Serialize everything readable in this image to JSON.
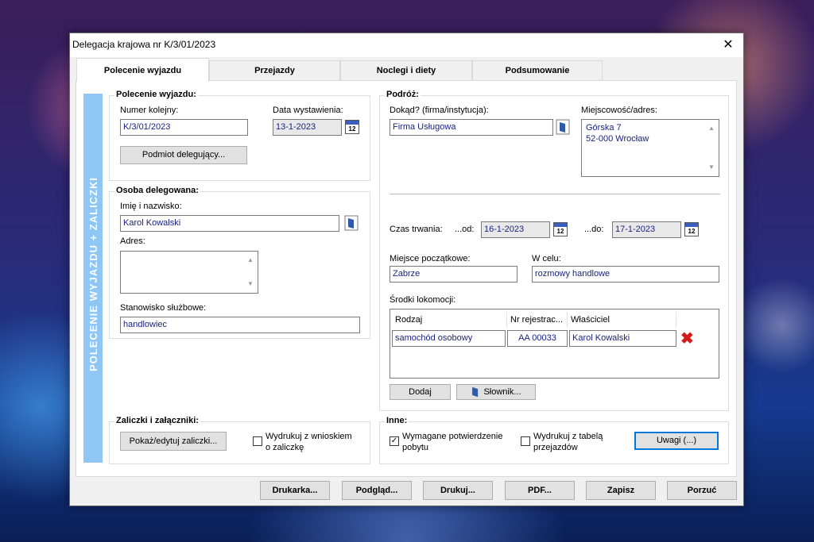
{
  "window": {
    "title": "Delegacja krajowa nr K/3/01/2023",
    "close_glyph": "✕"
  },
  "tabs": [
    "Polecenie wyjazdu",
    "Przejazdy",
    "Noclegi i diety",
    "Podsumowanie"
  ],
  "banner": "POLECENIE WYJAZDU + ZALICZKI",
  "polecenie": {
    "title": "Polecenie wyjazdu:",
    "numer_label": "Numer kolejny:",
    "numer_value": "K/3/01/2023",
    "data_label": "Data wystawienia:",
    "data_value": "13-1-2023",
    "podmiot_button": "Podmiot delegujący..."
  },
  "osoba": {
    "title": "Osoba delegowana:",
    "imie_label": "Imię i nazwisko:",
    "imie_value": "Karol Kowalski",
    "adres_label": "Adres:",
    "stanowisko_label": "Stanowisko służbowe:",
    "stanowisko_value": "handlowiec"
  },
  "podroz": {
    "title": "Podróż:",
    "dokad_label": "Dokąd? (firma/instytucja):",
    "dokad_value": "Firma Usługowa",
    "miejsc_label": "Miejscowość/adres:",
    "miejsc_line1": "Górska 7",
    "miejsc_line2": "52-000 Wrocław",
    "czas_label": "Czas trwania:",
    "od_label": "...od:",
    "od_value": "16-1-2023",
    "do_label": "...do:",
    "do_value": "17-1-2023",
    "poczatkowe_label": "Miejsce początkowe:",
    "poczatkowe_value": "Zabrze",
    "cel_label": "W celu:",
    "cel_value": "rozmowy handlowe",
    "srodki_label": "Środki lokomocji:",
    "columns": [
      "Rodzaj",
      "Nr rejestrac...",
      "Właściciel"
    ],
    "rows": [
      {
        "rodzaj": "samochód osobowy",
        "nr": "AA 00033",
        "wlasciciel": "Karol Kowalski"
      }
    ],
    "dodaj_button": "Dodaj",
    "slownik_button": "Słownik..."
  },
  "zaliczki": {
    "title": "Zaliczki i załączniki:",
    "pokaz_button": "Pokaż/edytuj zaliczki...",
    "wydrukuj_label_1": "Wydrukuj z wnioskiem",
    "wydrukuj_label_2": "o zaliczkę",
    "wydrukuj_checked": false
  },
  "inne": {
    "title": "Inne:",
    "wymagane_label_1": "Wymagane potwierdzenie",
    "wymagane_label_2": "pobytu",
    "wymagane_checked": true,
    "tabela_label_1": "Wydrukuj z tabelą",
    "tabela_label_2": "przejazdów",
    "tabela_checked": false,
    "uwagi_button": "Uwagi (...)"
  },
  "checkmark": "✓",
  "footer": [
    "Drukarka...",
    "Podgląd...",
    "Drukuj...",
    "PDF...",
    "Zapisz",
    "Porzuć"
  ],
  "icons": {
    "calendar": "calendar-icon",
    "book": "book-icon",
    "delete": "delete-icon",
    "calendar_day": "12",
    "delete_glyph": "✖"
  },
  "colors": {
    "banner": "#8fc6f3",
    "input_text": "#1a237e",
    "delete": "#d41a1a",
    "focus": "#0078d7"
  }
}
